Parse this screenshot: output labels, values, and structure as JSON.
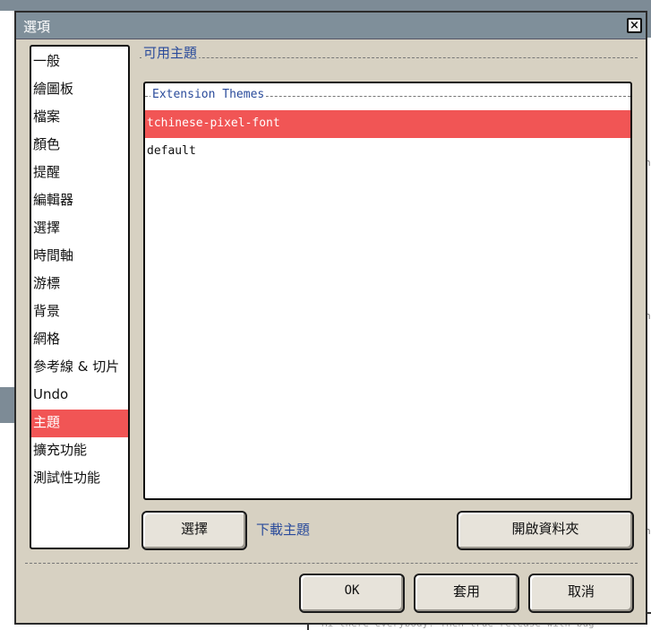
{
  "dialog": {
    "title": "選項",
    "close_label": "×"
  },
  "categories": [
    {
      "label": "一般"
    },
    {
      "label": "繪圖板"
    },
    {
      "label": "檔案"
    },
    {
      "label": "顏色"
    },
    {
      "label": "提醒"
    },
    {
      "label": "編輯器"
    },
    {
      "label": "選擇"
    },
    {
      "label": "時間軸"
    },
    {
      "label": "游標"
    },
    {
      "label": "背景"
    },
    {
      "label": "網格"
    },
    {
      "label": "參考線 & 切片"
    },
    {
      "label": "Undo"
    },
    {
      "label": "主題",
      "selected": true
    },
    {
      "label": "擴充功能"
    },
    {
      "label": "測試性功能"
    }
  ],
  "themes": {
    "section_title": "可用主題",
    "group_label": "Extension Themes",
    "items": [
      {
        "label": "tchinese-pixel-font",
        "selected": true
      },
      {
        "label": "default",
        "selected": false
      }
    ],
    "select_button": "選擇",
    "download_link": "下載主題",
    "open_folder_button": "開啟資料夾"
  },
  "footer": {
    "ok_button": "OK",
    "apply_button": "套用",
    "cancel_button": "取消"
  },
  "colors": {
    "selection": "#f15555",
    "dialog_bg": "#d7d1c2",
    "titlebar": "#7f8f9a",
    "link": "#2a4b9b"
  },
  "background": {
    "bottom_text": "Hi there everybody! Then true release with bug"
  }
}
